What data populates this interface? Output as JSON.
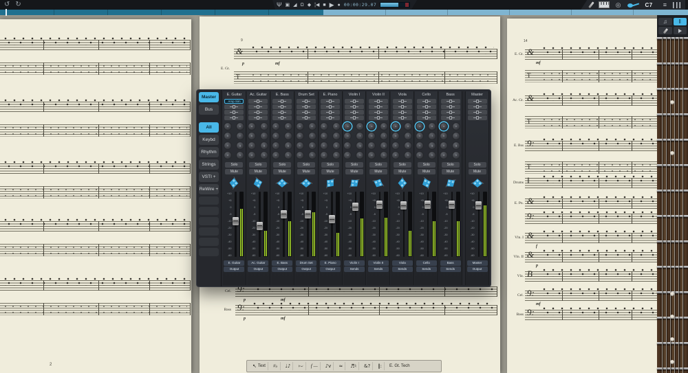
{
  "topbar": {
    "undo_glyph": "↺",
    "redo_glyph": "↻",
    "transport": {
      "time": "00:00:29.07",
      "icons": [
        {
          "name": "ntempo-hand-icon",
          "glyph": "Ψ",
          "big": true
        },
        {
          "name": "marker-overlay-icon",
          "glyph": "▣"
        },
        {
          "name": "ramp-icon",
          "glyph": "◢"
        },
        {
          "name": "mic-icon",
          "glyph": "Ω"
        },
        {
          "name": "metronome-icon",
          "glyph": "◆"
        },
        {
          "name": "rewind-button",
          "glyph": "¦◀",
          "interactable": true
        },
        {
          "name": "stop-button",
          "glyph": "■",
          "interactable": true
        },
        {
          "name": "play-button",
          "glyph": "▶",
          "big": true,
          "interactable": true
        },
        {
          "name": "record-button",
          "glyph": "●",
          "interactable": true
        }
      ]
    },
    "right_icons": [
      {
        "name": "pen-tool-icon",
        "shape": "pen"
      },
      {
        "name": "virtual-keyboard-icon",
        "shape": "keys"
      },
      {
        "name": "virtual-drumpad-icon",
        "glyph": "◎"
      },
      {
        "name": "virtual-fretboard-icon",
        "shape": "guitar",
        "active": true
      }
    ],
    "chord_display": "C7",
    "menu_icons": [
      {
        "name": "score-menu-icon",
        "glyph": "≡"
      },
      {
        "name": "mixer-toggle-icon",
        "shape": "mixer"
      }
    ]
  },
  "mixer": {
    "tabs": [
      {
        "label": "Master",
        "active": true
      },
      {
        "label": "Bus",
        "active": false
      }
    ],
    "groups": [
      {
        "label": "All",
        "active": true
      },
      {
        "label": "Keybd",
        "active": false
      },
      {
        "label": "Rhythm",
        "active": false
      },
      {
        "label": "Strings",
        "active": false
      },
      {
        "label": "VSTI  +",
        "active": false
      },
      {
        "label": "ReWire +",
        "active": false
      }
    ],
    "empty_slots": 6,
    "solo_label": "Solo",
    "mute_label": "Mute",
    "insert_slots_per_channel": 4,
    "fader_scale": [
      "+10",
      "+5",
      "0",
      "-5",
      "-10",
      "-20",
      "-30",
      "-40",
      "-50",
      "-60"
    ],
    "knob_letters": [
      "a",
      "e",
      "b",
      "f",
      "c",
      "g",
      "d",
      "h"
    ],
    "channels": [
      {
        "name": "E. Guitar",
        "route": "Output",
        "insert1": "Amp Sim",
        "knob_hl": false,
        "fader": 0.45,
        "meter": 0.72,
        "knobs": true,
        "master": false
      },
      {
        "name": "Ac. Guitar",
        "route": "Output",
        "insert1": null,
        "knob_hl": false,
        "fader": 0.53,
        "meter": 0.38,
        "knobs": true,
        "master": false
      },
      {
        "name": "E. Bass",
        "route": "Output",
        "insert1": null,
        "knob_hl": false,
        "fader": 0.33,
        "meter": 0.53,
        "knobs": true,
        "master": false
      },
      {
        "name": "Drum Set",
        "route": "Output",
        "insert1": null,
        "knob_hl": false,
        "fader": 0.33,
        "meter": 0.67,
        "knobs": true,
        "master": false
      },
      {
        "name": "E. Piano",
        "route": "Output",
        "insert1": null,
        "knob_hl": false,
        "fader": 0.42,
        "meter": 0.35,
        "knobs": true,
        "master": false
      },
      {
        "name": "Violin I",
        "route": "Sends",
        "insert1": null,
        "knob_hl": true,
        "fader": 0.2,
        "meter": 0.57,
        "knobs": true,
        "master": false
      },
      {
        "name": "Violin II",
        "route": "Sends",
        "insert1": null,
        "knob_hl": true,
        "fader": 0.16,
        "meter": 0.58,
        "knobs": true,
        "master": false
      },
      {
        "name": "Viola",
        "route": "Sends",
        "insert1": null,
        "knob_hl": true,
        "fader": 0.18,
        "meter": 0.38,
        "knobs": true,
        "master": false
      },
      {
        "name": "Cello",
        "route": "Sends",
        "insert1": null,
        "knob_hl": true,
        "fader": 0.16,
        "meter": 0.53,
        "knobs": true,
        "master": false
      },
      {
        "name": "Bass",
        "route": "Sends",
        "insert1": null,
        "knob_hl": true,
        "fader": 0.16,
        "meter": 0.53,
        "knobs": true,
        "master": false
      },
      {
        "name": "Master",
        "route": "Output",
        "insert1": null,
        "knob_hl": false,
        "fader": 0.18,
        "meter": 0.77,
        "knobs": false,
        "master": true
      }
    ]
  },
  "score": {
    "left_page": {
      "page_number": "2"
    },
    "center_page": {
      "measure_number": "9",
      "top_instrument": "E. Gt.",
      "bottom_instruments": [
        "Cel.",
        "Bass"
      ],
      "dynamics": [
        "p",
        "mf"
      ]
    },
    "right_page": {
      "measure_number": "14",
      "instruments": [
        "E. Gt.",
        "Ac. Gt.",
        "E. Bss",
        "Drums",
        "E. Pn.",
        "Vln. I",
        "Vln. II",
        "Vla.",
        "Cel.",
        "Bass"
      ],
      "dynamics": [
        {
          "mark": "mf",
          "sys": 0
        },
        {
          "mark": "f",
          "sys": 5
        },
        {
          "mark": "p",
          "sys": 6
        },
        {
          "mark": "mf",
          "sys": 8
        }
      ]
    }
  },
  "palette": {
    "items": [
      {
        "glyph": "↖",
        "label": "Text"
      },
      {
        "glyph": "♯♭"
      },
      {
        "glyph": "♩♪"
      },
      {
        "glyph": "›⌣"
      },
      {
        "glyph": "f —",
        "italic": true
      },
      {
        "glyph": "♪v"
      },
      {
        "glyph": "≈"
      },
      {
        "glyph": "♬♮"
      },
      {
        "glyph": "&?"
      },
      {
        "glyph": "‖:"
      },
      {
        "label": "E. Gt. Tech",
        "small": true
      }
    ]
  },
  "fretboard": {
    "buttons": [
      {
        "name": "notes-mode-button",
        "glyph": "♫",
        "active": false
      },
      {
        "name": "fret-number-mode-button",
        "glyph": "‖",
        "active": true
      },
      {
        "name": "edit-pencil-button",
        "shape": "pen",
        "active": false
      },
      {
        "name": "audition-speaker-button",
        "shape": "spk",
        "active": false
      }
    ]
  },
  "colors": {
    "accent": "#49b8e8",
    "meter_green": "#a6d62b",
    "pan_blue": "#2f9fd6",
    "timeline_dark": "#20708f",
    "timeline_light": "#7fb5d1"
  }
}
